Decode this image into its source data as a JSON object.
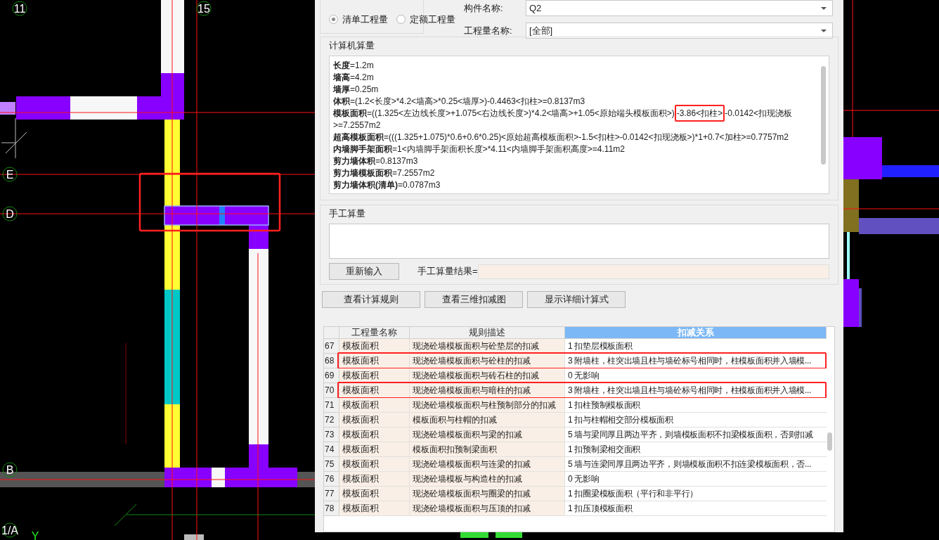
{
  "canvas": {
    "axis_labels": [
      "11",
      "15",
      "E",
      "D",
      "B",
      "1/A"
    ],
    "y_axis": "Y",
    "highlight": true
  },
  "dialog": {
    "filter_group": {
      "options": [
        {
          "label": "清单工程量",
          "selected": true
        },
        {
          "label": "定额工程量",
          "selected": false
        }
      ]
    },
    "fields": [
      {
        "label": "构件名称:",
        "value": "Q2"
      },
      {
        "label": "工程量名称:",
        "value": "[全部]"
      }
    ],
    "computer_calc": {
      "title": "计算机算量",
      "lines": [
        "**长度**=1.2m",
        "**墙高**=4.2m",
        "**墙厚**=0.25m",
        "**体积**=(1.2<长度>*4.2<墙高>*0.25<墙厚>)-0.4463<扣柱>=0.8137m3",
        {
          "text": "**模板面积**=((1.325<左边线长度>+1.075<右边线长度>)*4.2<墙高>+1.05<原始端头模板面积>)",
          "marked": "-3.86<扣柱>",
          "text_after": "-0.0142<扣现浇板>=7.2557m2"
        },
        "**超高模板面积**=(((1.325+1.075)*0.6+0.6*0.25)<原始超高模板面积>-1.5<扣柱>-0.0142<扣现浇板>)*1+0.7<加柱>=0.7757m2",
        "**内墙脚手架面积**=1<内墙脚手架面积长度>*4.11<内墙脚手架面积高度>=4.11m2",
        "**剪力墙体积**=0.8137m3",
        "**剪力墙模板面积**=7.2557m2",
        "**剪力墙体积(清单)**=0.0787m3"
      ]
    },
    "manual_calc": {
      "title": "手工算量",
      "reset_button": "重新输入",
      "result_label": "手工算量结果="
    },
    "buttons": [
      "查看计算规则",
      "查看三维扣减图",
      "显示详细计算式"
    ],
    "table": {
      "columns": [
        {
          "label": "工程量名称",
          "selected": false
        },
        {
          "label": "规则描述",
          "selected": false
        },
        {
          "label": "扣减关系",
          "selected": true
        }
      ],
      "rows": [
        {
          "no": "67",
          "name": "模板面积",
          "rule": "现浇砼墙模板面积与砼垫层的扣减",
          "relation": "1  扣垫层模板面积",
          "highlighted": false
        },
        {
          "no": "68",
          "name": "模板面积",
          "rule": "现浇砼墙模板面积与砼柱的扣减",
          "relation": "3  附墙柱，柱突出墙且柱与墙砼标号相同时，柱模板面积并入墙模...",
          "highlighted": true
        },
        {
          "no": "69",
          "name": "模板面积",
          "rule": "现浇砼墙模板面积与砖石柱的扣减",
          "relation": "0  无影响",
          "highlighted": false
        },
        {
          "no": "70",
          "name": "模板面积",
          "rule": "现浇砼墙模板面积与暗柱的扣减",
          "relation": "3  附墙柱，柱突出墙且柱与墙砼标号相同时，柱模板面积并入墙模...",
          "highlighted": true
        },
        {
          "no": "71",
          "name": "模板面积",
          "rule": "现浇砼墙模板面积与柱预制部分的扣减",
          "relation": "1  扣柱预制模板面积",
          "highlighted": false
        },
        {
          "no": "72",
          "name": "模板面积",
          "rule": "模板面积与柱帽的扣减",
          "relation": "1 扣与柱帽相交部分模板面积",
          "highlighted": false
        },
        {
          "no": "73",
          "name": "模板面积",
          "rule": "现浇砼墙模板面积与梁的扣减",
          "relation": "5  墙与梁同厚且两边平齐，则墙模板面积不扣梁模板面积，否则扣减",
          "highlighted": false
        },
        {
          "no": "74",
          "name": "模板面积",
          "rule": "模板面积扣预制梁面积",
          "relation": "1  扣预制梁相交面积",
          "highlighted": false
        },
        {
          "no": "75",
          "name": "模板面积",
          "rule": "现浇砼墙模板面积与连梁的扣减",
          "relation": "5 墙与连梁同厚且两边平齐，则墙模板面积不扣连梁模板面积，否...",
          "highlighted": false
        },
        {
          "no": "76",
          "name": "模板面积",
          "rule": "现浇砼墙模板与构造柱的扣减",
          "relation": "0  无影响",
          "highlighted": false
        },
        {
          "no": "77",
          "name": "模板面积",
          "rule": "现浇砼墙模板面积与圈梁的扣减",
          "relation": "1  扣圈梁模板面积（平行和非平行）",
          "highlighted": false
        },
        {
          "no": "78",
          "name": "模板面积",
          "rule": "现浇砼墙模板面积与压顶的扣减",
          "relation": "1  扣压顶模板面积",
          "highlighted": false
        }
      ]
    }
  }
}
